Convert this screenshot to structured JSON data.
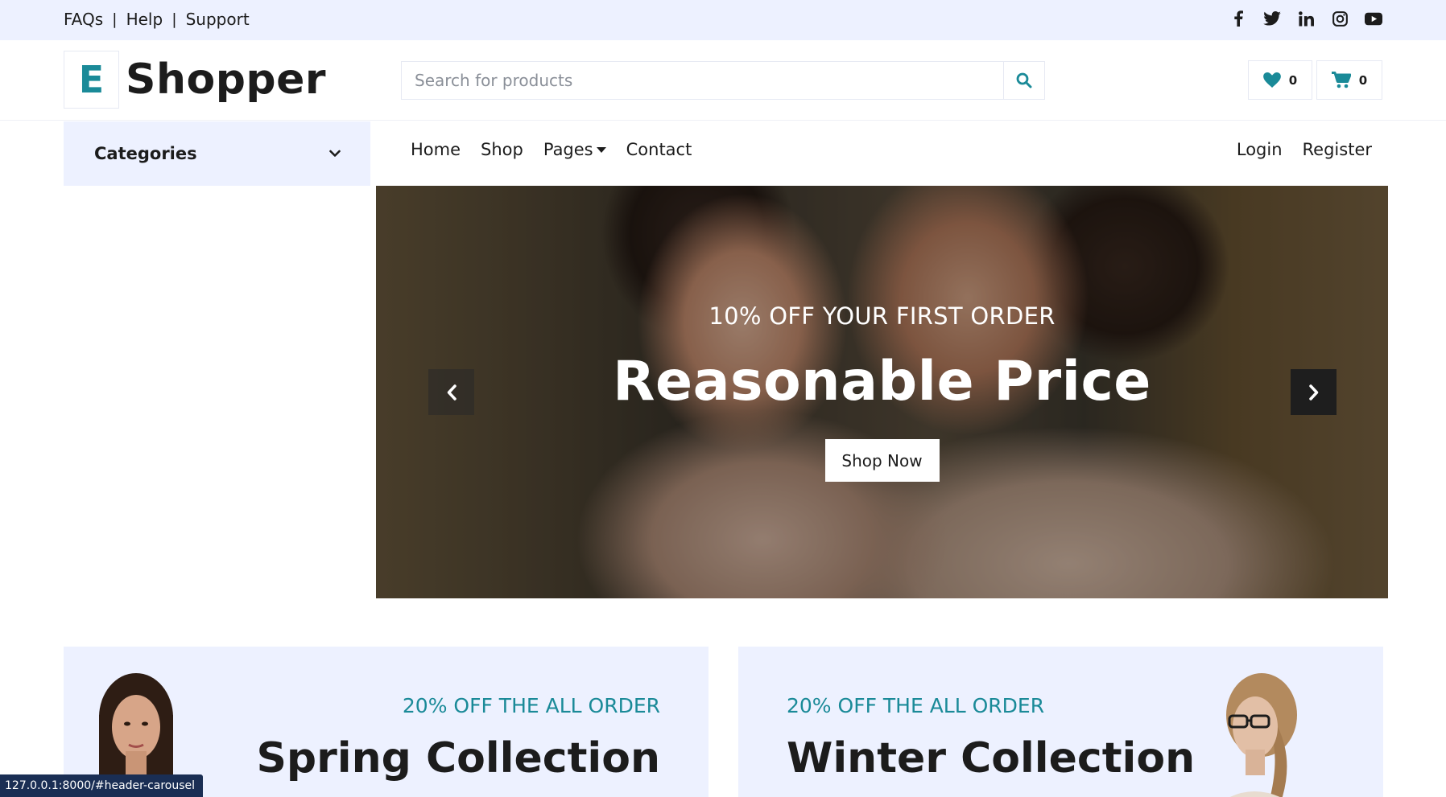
{
  "topbar": {
    "links": [
      "FAQs",
      "Help",
      "Support"
    ],
    "separator": "|",
    "social_icons": [
      "facebook-icon",
      "twitter-icon",
      "linkedin-icon",
      "instagram-icon",
      "youtube-icon"
    ]
  },
  "header": {
    "logo_letter": "E",
    "logo_text": "Shopper",
    "search_placeholder": "Search for products",
    "wishlist_count": "0",
    "cart_count": "0"
  },
  "nav": {
    "categories_label": "Categories",
    "links": [
      "Home",
      "Shop",
      "Pages",
      "Contact"
    ],
    "auth": [
      "Login",
      "Register"
    ]
  },
  "carousel": {
    "subtitle": "10% OFF YOUR FIRST ORDER",
    "title": "Reasonable Price",
    "button": "Shop Now"
  },
  "offers": [
    {
      "tag": "20% OFF THE ALL ORDER",
      "title": "Spring Collection"
    },
    {
      "tag": "20% OFF THE ALL ORDER",
      "title": "Winter Collection"
    }
  ],
  "status_url": "127.0.0.1:8000/#header-carousel",
  "colors": {
    "accent": "#1a8a98",
    "light_bg": "#edf1ff",
    "text": "#1c1c1c"
  }
}
